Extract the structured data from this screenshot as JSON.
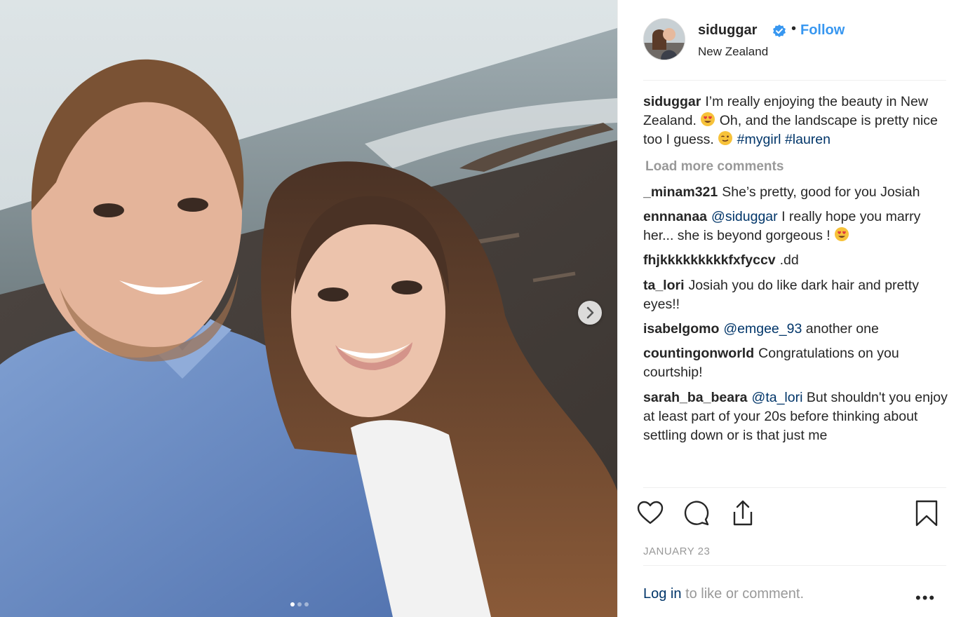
{
  "post": {
    "username": "siduggar",
    "separator": "•",
    "follow_label": "Follow",
    "location": "New Zealand",
    "carousel": {
      "total_slides": 3,
      "active_slide": 1
    },
    "caption": {
      "username": "siduggar",
      "text_1": "I’m really enjoying the beauty in New Zealand.",
      "emoji_1": "heart-eyes",
      "text_2": "Oh, and the landscape is pretty nice too I guess.",
      "emoji_2": "wink",
      "hashtag_1": "#mygirl",
      "hashtag_2": "#lauren"
    },
    "load_more": "Load more comments",
    "comments": [
      {
        "username": "_minam321",
        "text": "She’s pretty, good for you Josiah"
      },
      {
        "username": "ennnanaa",
        "mention": "@siduggar",
        "text": "I really hope you marry her... she is beyond gorgeous !",
        "emoji": "heart-eyes"
      },
      {
        "username": "fhjkkkkkkkkkfxfyccv",
        "text": ".dd"
      },
      {
        "username": "ta_lori",
        "text": "Josiah you do like dark hair and pretty eyes!!"
      },
      {
        "username": "isabelgomo",
        "mention": "@emgee_93",
        "text": "another one"
      },
      {
        "username": "countingonworld",
        "text": "Congratulations on you courtship!"
      },
      {
        "username": "sarah_ba_beara",
        "mention": "@ta_lori",
        "text": "But shouldn't you enjoy at least part of your 20s before thinking about settling down or is that just me"
      }
    ],
    "date": "JANUARY 23",
    "login_link": "Log in",
    "login_rest": "to like or comment.",
    "more_label": "•••"
  },
  "icons": [
    "chevron-right-icon",
    "verified-icon",
    "heart-icon",
    "comment-icon",
    "share-icon",
    "bookmark-icon"
  ],
  "colors": {
    "link_blue": "#3897f0",
    "mention_blue": "#003569",
    "muted": "#999999",
    "text": "#262626"
  }
}
